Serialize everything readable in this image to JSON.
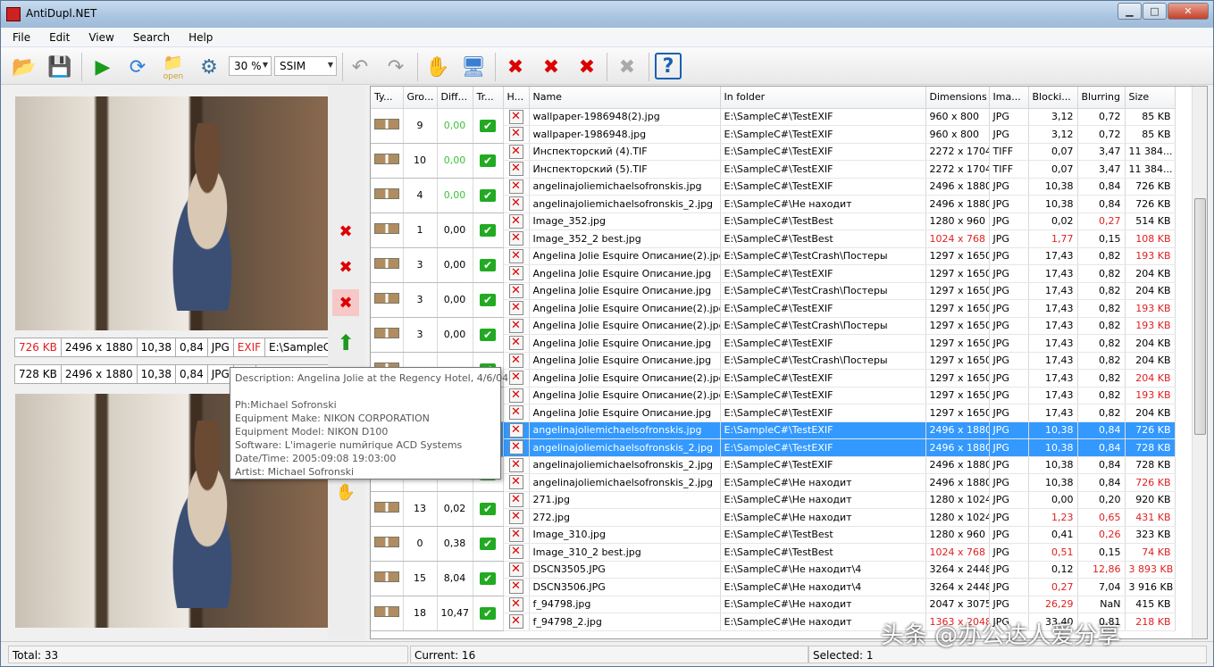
{
  "window": {
    "title": "AntiDupl.NET"
  },
  "menu": [
    "File",
    "Edit",
    "View",
    "Search",
    "Help"
  ],
  "toolbar": {
    "zoom": "30 %",
    "algorithm": "SSIM",
    "open_label": "open"
  },
  "top_image": {
    "size": "726 KB",
    "dimensions": "2496 x 1880",
    "blocking": "10,38",
    "blurring": "0,84",
    "type": "JPG",
    "exif": "EXIF",
    "path": "E:\\SampleC#\\..."
  },
  "bottom_image": {
    "size": "728 KB",
    "dimensions": "2496 x 1880",
    "blocking": "10,38",
    "blurring": "0,84",
    "type": "JPG",
    "exif": "EX"
  },
  "tooltip": {
    "description": "Description: Angelina Jolie at the Regency Hotel, 4/6/04",
    "blank": "",
    "ph": "Ph:Michael Sofronski",
    "make": "Equipment Make: NIKON CORPORATION",
    "model": "Equipment Model: NIKON D100",
    "software": "Software: L'imagerie numйrique ACD Systems",
    "datetime": "Date/Time: 2005:09:08 19:03:00",
    "artist": "Artist: Michael Sofronski"
  },
  "columns": [
    "Ty...",
    "Gro...",
    "Diff...",
    "Tr...",
    "H...",
    "Name",
    "In folder",
    "Dimensions",
    "Ima...",
    "Blocki...",
    "Blurring",
    "Size"
  ],
  "groups": [
    {
      "group": "9",
      "diff": "0,00",
      "diff_green": true,
      "rows": [
        {
          "name": "wallpaper-1986948(2).jpg",
          "folder": "E:\\SampleC#\\TestEXIF",
          "dim": "960 x 800",
          "type": "JPG",
          "block": "3,12",
          "blur": "0,72",
          "size": "85 KB"
        },
        {
          "name": "wallpaper-1986948.jpg",
          "folder": "E:\\SampleC#\\TestEXIF",
          "dim": "960 x 800",
          "type": "JPG",
          "block": "3,12",
          "blur": "0,72",
          "size": "85 KB"
        }
      ]
    },
    {
      "group": "10",
      "diff": "0,00",
      "diff_green": true,
      "rows": [
        {
          "name": "Инспекторский (4).TIF",
          "folder": "E:\\SampleC#\\TestEXIF",
          "dim": "2272 x 1704",
          "type": "TIFF",
          "block": "0,07",
          "blur": "3,47",
          "size": "11 384..."
        },
        {
          "name": "Инспекторский (5).TIF",
          "folder": "E:\\SampleC#\\TestEXIF",
          "dim": "2272 x 1704",
          "type": "TIFF",
          "block": "0,07",
          "blur": "3,47",
          "size": "11 384..."
        }
      ]
    },
    {
      "group": "4",
      "diff": "0,00",
      "diff_green": true,
      "rows": [
        {
          "name": "angelinajoliemichaelsofronskis.jpg",
          "folder": "E:\\SampleC#\\TestEXIF",
          "dim": "2496 x 1880",
          "type": "JPG",
          "block": "10,38",
          "blur": "0,84",
          "size": "726 KB"
        },
        {
          "name": "angelinajoliemichaelsofronskis_2.jpg",
          "folder": "E:\\SampleC#\\Не находит",
          "dim": "2496 x 1880",
          "type": "JPG",
          "block": "10,38",
          "blur": "0,84",
          "size": "726 KB"
        }
      ]
    },
    {
      "group": "1",
      "diff": "0,00",
      "rows": [
        {
          "name": "Image_352.jpg",
          "folder": "E:\\SampleC#\\TestBest",
          "dim": "1280 x 960",
          "type": "JPG",
          "block": "0,02",
          "blur": "0,27",
          "size": "514 KB",
          "red": [
            "blur"
          ]
        },
        {
          "name": "Image_352_2 best.jpg",
          "folder": "E:\\SampleC#\\TestBest",
          "dim": "1024 x 768",
          "type": "JPG",
          "block": "1,77",
          "blur": "0,15",
          "size": "108 KB",
          "red": [
            "dim",
            "block",
            "size"
          ]
        }
      ]
    },
    {
      "group": "3",
      "diff": "0,00",
      "rows": [
        {
          "name": "Angelina Jolie Esquire Описание(2).jpg",
          "folder": "E:\\SampleC#\\TestCrash\\Постеры",
          "dim": "1297 x 1650",
          "type": "JPG",
          "block": "17,43",
          "blur": "0,82",
          "size": "193 KB",
          "red": [
            "size"
          ]
        },
        {
          "name": "Angelina Jolie Esquire Описание.jpg",
          "folder": "E:\\SampleC#\\TestEXIF",
          "dim": "1297 x 1650",
          "type": "JPG",
          "block": "17,43",
          "blur": "0,82",
          "size": "204 KB"
        }
      ]
    },
    {
      "group": "3",
      "diff": "0,00",
      "rows": [
        {
          "name": "Angelina Jolie Esquire Описание.jpg",
          "folder": "E:\\SampleC#\\TestCrash\\Постеры",
          "dim": "1297 x 1650",
          "type": "JPG",
          "block": "17,43",
          "blur": "0,82",
          "size": "204 KB"
        },
        {
          "name": "Angelina Jolie Esquire Описание(2).jpg",
          "folder": "E:\\SampleC#\\TestEXIF",
          "dim": "1297 x 1650",
          "type": "JPG",
          "block": "17,43",
          "blur": "0,82",
          "size": "193 KB",
          "red": [
            "size"
          ]
        }
      ]
    },
    {
      "group": "3",
      "diff": "0,00",
      "rows": [
        {
          "name": "Angelina Jolie Esquire Описание(2).jpg",
          "folder": "E:\\SampleC#\\TestCrash\\Постеры",
          "dim": "1297 x 1650",
          "type": "JPG",
          "block": "17,43",
          "blur": "0,82",
          "size": "193 KB",
          "red": [
            "size"
          ]
        },
        {
          "name": "Angelina Jolie Esquire Описание.jpg",
          "folder": "E:\\SampleC#\\TestEXIF",
          "dim": "1297 x 1650",
          "type": "JPG",
          "block": "17,43",
          "blur": "0,82",
          "size": "204 KB"
        }
      ]
    },
    {
      "group": "",
      "diff": "",
      "rows": [
        {
          "name": "Angelina Jolie Esquire Описание.jpg",
          "folder": "E:\\SampleC#\\TestCrash\\Постеры",
          "dim": "1297 x 1650",
          "type": "JPG",
          "block": "17,43",
          "blur": "0,82",
          "size": "204 KB"
        },
        {
          "name": "Angelina Jolie Esquire Описание(2).jpg",
          "folder": "E:\\SampleC#\\TestEXIF",
          "dim": "1297 x 1650",
          "type": "JPG",
          "block": "17,43",
          "blur": "0,82",
          "size": "204 KB",
          "red": [
            "size"
          ]
        }
      ]
    },
    {
      "group": "",
      "diff": "",
      "rows": [
        {
          "name": "Angelina Jolie Esquire Описание(2).jpg",
          "folder": "E:\\SampleC#\\TestEXIF",
          "dim": "1297 x 1650",
          "type": "JPG",
          "block": "17,43",
          "blur": "0,82",
          "size": "193 KB",
          "red": [
            "size"
          ]
        },
        {
          "name": "Angelina Jolie Esquire Описание.jpg",
          "folder": "E:\\SampleC#\\TestEXIF",
          "dim": "1297 x 1650",
          "type": "JPG",
          "block": "17,43",
          "blur": "0,82",
          "size": "204 KB"
        }
      ]
    },
    {
      "group": "",
      "diff": "",
      "selected": true,
      "rows": [
        {
          "name": "angelinajoliemichaelsofronskis.jpg",
          "folder": "E:\\SampleC#\\TestEXIF",
          "dim": "2496 x 1880",
          "type": "JPG",
          "block": "10,38",
          "blur": "0,84",
          "size": "726 KB",
          "red": [
            "size"
          ]
        },
        {
          "name": "angelinajoliemichaelsofronskis_2.jpg",
          "folder": "E:\\SampleC#\\TestEXIF",
          "dim": "2496 x 1880",
          "type": "JPG",
          "block": "10,38",
          "blur": "0,84",
          "size": "728 KB"
        }
      ]
    },
    {
      "group": "",
      "diff": "",
      "rows": [
        {
          "name": "angelinajoliemichaelsofronskis_2.jpg",
          "folder": "E:\\SampleC#\\TestEXIF",
          "dim": "2496 x 1880",
          "type": "JPG",
          "block": "10,38",
          "blur": "0,84",
          "size": "728 KB"
        },
        {
          "name": "angelinajoliemichaelsofronskis_2.jpg",
          "folder": "E:\\SampleC#\\Не находит",
          "dim": "2496 x 1880",
          "type": "JPG",
          "block": "10,38",
          "blur": "0,84",
          "size": "726 KB",
          "red": [
            "size"
          ]
        }
      ]
    },
    {
      "group": "13",
      "diff": "0,02",
      "rows": [
        {
          "name": "271.jpg",
          "folder": "E:\\SampleC#\\Не находит",
          "dim": "1280 x 1024",
          "type": "JPG",
          "block": "0,00",
          "blur": "0,20",
          "size": "920 KB"
        },
        {
          "name": "272.jpg",
          "folder": "E:\\SampleC#\\Не находит",
          "dim": "1280 x 1024",
          "type": "JPG",
          "block": "1,23",
          "blur": "0,65",
          "size": "431 KB",
          "red": [
            "block",
            "blur",
            "size"
          ]
        }
      ]
    },
    {
      "group": "0",
      "diff": "0,38",
      "rows": [
        {
          "name": "Image_310.jpg",
          "folder": "E:\\SampleC#\\TestBest",
          "dim": "1280 x 960",
          "type": "JPG",
          "block": "0,41",
          "blur": "0,26",
          "size": "323 KB",
          "red": [
            "blur"
          ]
        },
        {
          "name": "Image_310_2 best.jpg",
          "folder": "E:\\SampleC#\\TestBest",
          "dim": "1024 x 768",
          "type": "JPG",
          "block": "0,51",
          "blur": "0,15",
          "size": "74 KB",
          "red": [
            "dim",
            "block",
            "size"
          ]
        }
      ]
    },
    {
      "group": "15",
      "diff": "8,04",
      "rows": [
        {
          "name": "DSCN3505.JPG",
          "folder": "E:\\SampleC#\\Не находит\\4",
          "dim": "3264 x 2448",
          "type": "JPG",
          "block": "0,12",
          "blur": "12,86",
          "size": "3 893 KB",
          "red": [
            "blur",
            "size"
          ]
        },
        {
          "name": "DSCN3506.JPG",
          "folder": "E:\\SampleC#\\Не находит\\4",
          "dim": "3264 x 2448",
          "type": "JPG",
          "block": "0,27",
          "blur": "7,04",
          "size": "3 916 KB",
          "red": [
            "block"
          ]
        }
      ]
    },
    {
      "group": "18",
      "diff": "10,47",
      "rows": [
        {
          "name": "f_94798.jpg",
          "folder": "E:\\SampleC#\\Не находит",
          "dim": "2047 x 3075",
          "type": "JPG",
          "block": "26,29",
          "blur": "NaN",
          "size": "415 KB",
          "red": [
            "block"
          ]
        },
        {
          "name": "f_94798_2.jpg",
          "folder": "E:\\SampleC#\\Не находит",
          "dim": "1363 x 2048",
          "type": "JPG",
          "block": "33,40",
          "blur": "0,81",
          "size": "218 KB",
          "red": [
            "dim",
            "size"
          ]
        }
      ]
    }
  ],
  "status": {
    "total": "Total: 33",
    "current": "Current: 16",
    "selected": "Selected: 1"
  },
  "watermark": "头条 @办公达人爱分享"
}
